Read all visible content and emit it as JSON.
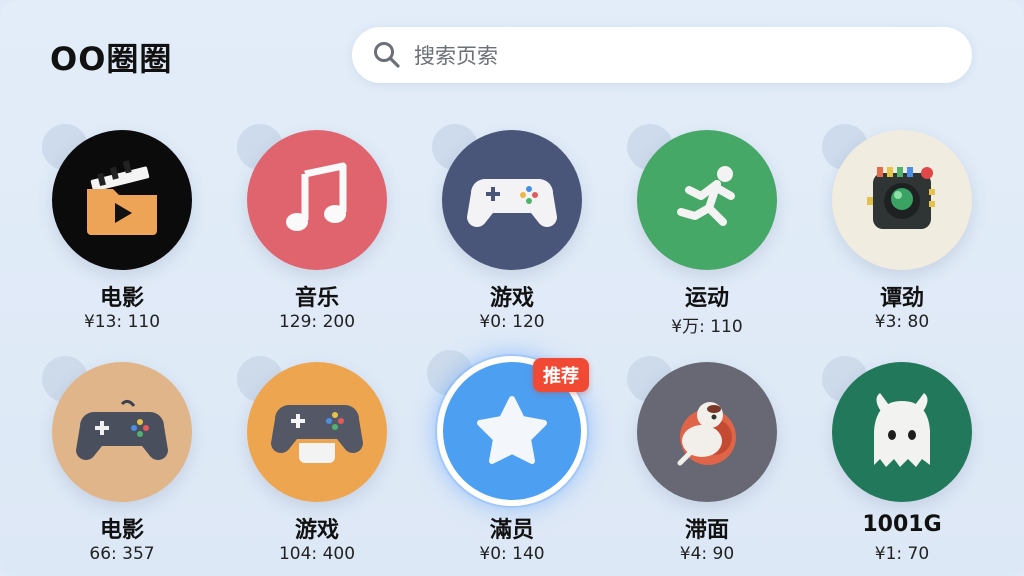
{
  "app": {
    "title": "OO圈圈"
  },
  "search": {
    "placeholder": "搜索页索",
    "icon": "search-icon"
  },
  "colors": {
    "movie": "#0b0b0b",
    "music": "#e0646e",
    "game": "#4a557a",
    "sport": "#46a867",
    "misc": "#f1ece0",
    "tan": "#e0b589",
    "orange": "#eea550",
    "blue": "#4d9ff2",
    "gray": "#676873",
    "green": "#21785b",
    "badge": "#f04a35"
  },
  "tiles": [
    {
      "name": "电影",
      "stat": "¥13: 110",
      "icon": "film-folder-icon"
    },
    {
      "name": "音乐",
      "stat": "129: 200",
      "icon": "music-note-icon"
    },
    {
      "name": "游戏",
      "stat": "¥0: 120",
      "icon": "gamepad-icon"
    },
    {
      "name": "运动",
      "stat": "¥万: 110",
      "icon": "running-man-icon"
    },
    {
      "name": "谭劲",
      "stat": "¥3: 80",
      "icon": "board-game-icon"
    },
    {
      "name": "电影",
      "stat": "66: 357",
      "icon": "controller-icon"
    },
    {
      "name": "游戏",
      "stat": "104: 400",
      "icon": "controller-orange-icon"
    },
    {
      "name": "滿员",
      "stat": "¥0: 140",
      "icon": "star-icon",
      "badge": "推荐"
    },
    {
      "name": "滞面",
      "stat": "¥4: 90",
      "icon": "mascot-icon"
    },
    {
      "name": "1001G",
      "stat": "¥1: 70",
      "icon": "ghost-icon"
    }
  ]
}
